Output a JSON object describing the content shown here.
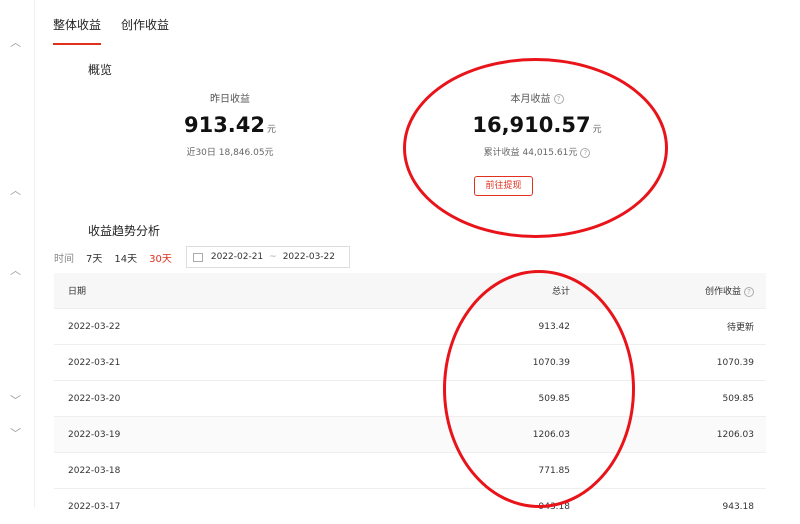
{
  "tabs": [
    {
      "label": "整体收益",
      "active": true
    },
    {
      "label": "创作收益",
      "active": false
    }
  ],
  "overview": {
    "title": "概览",
    "yesterday": {
      "label": "昨日收益",
      "value": "913.42",
      "unit": "元",
      "sub": "近30日 18,846.05元"
    },
    "month": {
      "label": "本月收益",
      "value": "16,910.57",
      "unit": "元",
      "sub": "累计收益 44,015.61元"
    },
    "withdraw_label": "前往提现"
  },
  "trend": {
    "title": "收益趋势分析",
    "time_label": "时间",
    "options": [
      {
        "label": "7天",
        "active": false
      },
      {
        "label": "14天",
        "active": false
      },
      {
        "label": "30天",
        "active": true
      }
    ],
    "start_date": "2022-02-21",
    "separator": "~",
    "end_date": "2022-03-22"
  },
  "table": {
    "headers": [
      "日期",
      "总计",
      "创作收益"
    ],
    "rows": [
      [
        "2022-03-22",
        "913.42",
        "待更新"
      ],
      [
        "2022-03-21",
        "1070.39",
        "1070.39"
      ],
      [
        "2022-03-20",
        "509.85",
        "509.85"
      ],
      [
        "2022-03-19",
        "1206.03",
        "1206.03"
      ],
      [
        "2022-03-18",
        "771.85",
        ""
      ],
      [
        "2022-03-17",
        "943.18",
        "943.18"
      ]
    ]
  },
  "colors": {
    "accent": "#e0301e",
    "annotation": "#e8141a"
  }
}
